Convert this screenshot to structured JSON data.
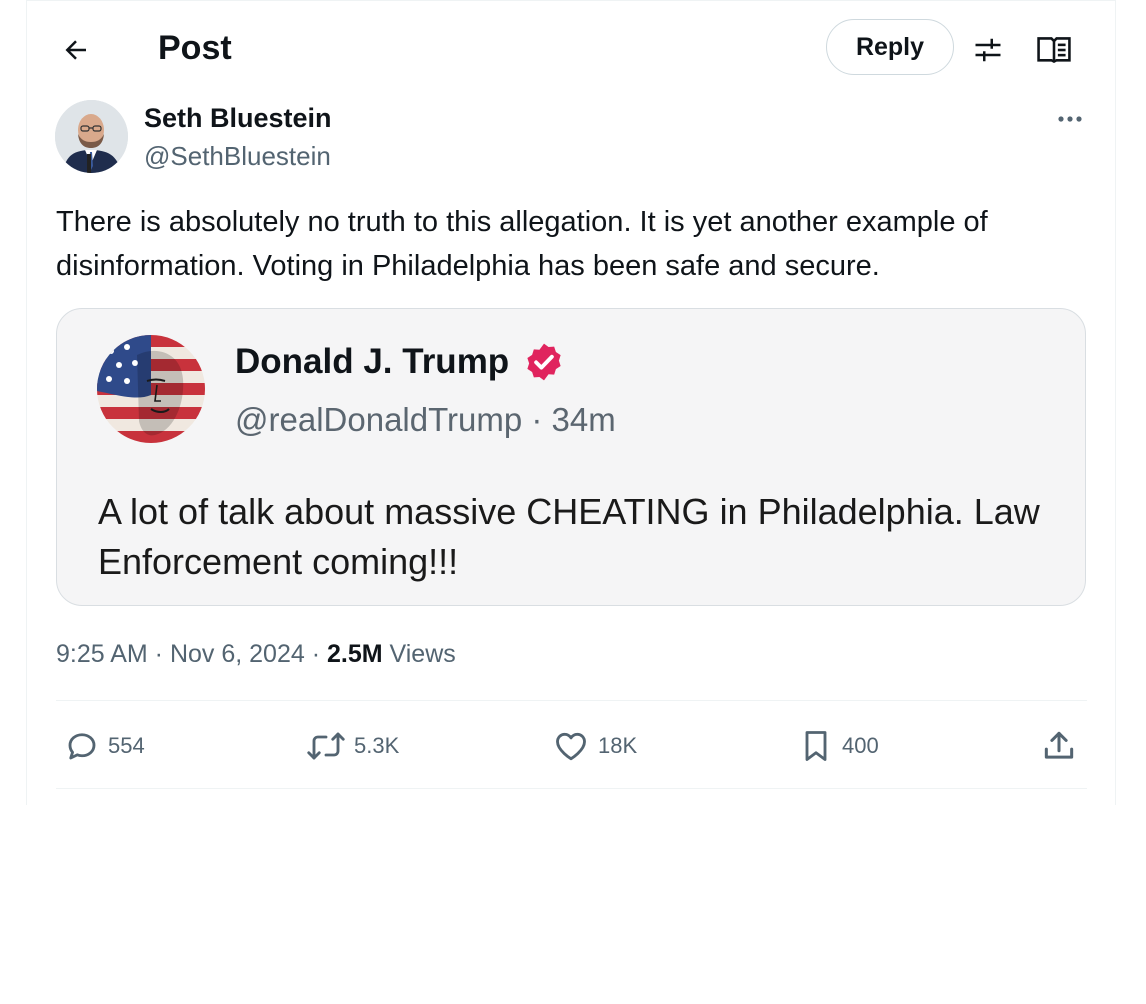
{
  "header": {
    "title": "Post",
    "reply_label": "Reply",
    "icons": [
      "back-arrow-icon",
      "sliders-icon",
      "reader-icon"
    ]
  },
  "post": {
    "author": {
      "name": "Seth Bluestein",
      "handle": "@SethBluestein"
    },
    "text": "There is absolutely no truth to this allegation. It is yet another example of\ndisinformation. Voting in Philadelphia has been safe and secure.",
    "quoted": {
      "name": "Donald J. Trump",
      "handle_time": "@realDonaldTrump · 34m",
      "verified_badge_color": "#e0245e",
      "text": "A lot of talk about massive CHEATING in Philadelphia. Law Enforcement coming!!!"
    },
    "meta": {
      "timestamp": "9:25 AM · Nov 6, 2024 · ",
      "views_count": "2.5M",
      "views_label": " Views"
    },
    "actions": {
      "replies": "554",
      "reposts": "5.3K",
      "likes": "18K",
      "bookmarks": "400"
    }
  }
}
